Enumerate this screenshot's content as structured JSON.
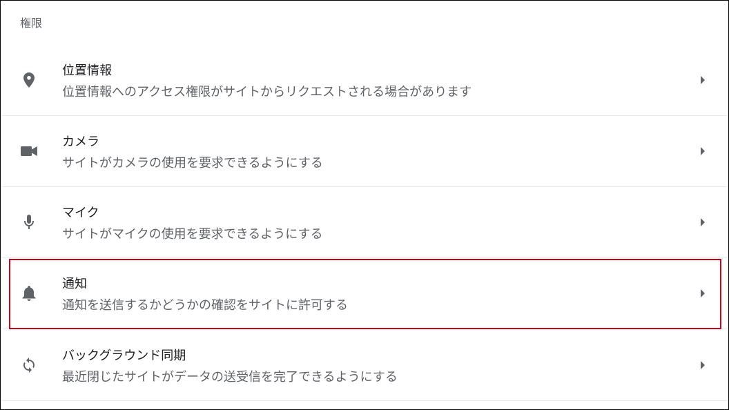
{
  "section": {
    "header": "権限"
  },
  "rows": [
    {
      "title": "位置情報",
      "subtitle": "位置情報へのアクセス権限がサイトからリクエストされる場合があります",
      "icon": "location-pin-icon"
    },
    {
      "title": "カメラ",
      "subtitle": "サイトがカメラの使用を要求できるようにする",
      "icon": "videocam-icon"
    },
    {
      "title": "マイク",
      "subtitle": "サイトがマイクの使用を要求できるようにする",
      "icon": "mic-icon"
    },
    {
      "title": "通知",
      "subtitle": "通知を送信するかどうかの確認をサイトに許可する",
      "icon": "bell-icon",
      "highlighted": true
    },
    {
      "title": "バックグラウンド同期",
      "subtitle": "最近閉じたサイトがデータの送受信を完了できるようにする",
      "icon": "sync-icon"
    }
  ],
  "colors": {
    "icon": "#5f6368",
    "highlight": "#d0021b",
    "divider": "#e8eaed"
  }
}
